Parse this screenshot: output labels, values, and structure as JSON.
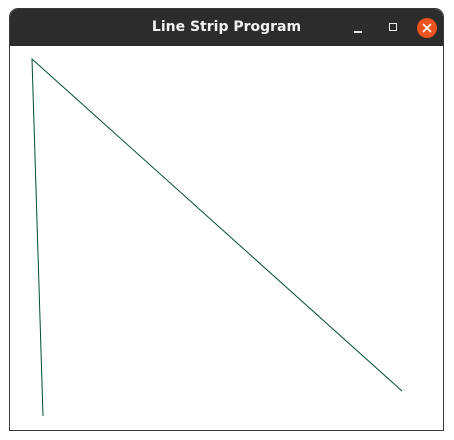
{
  "window": {
    "title": "Line Strip Program",
    "controls": {
      "minimize_icon": "minimize-icon",
      "maximize_icon": "maximize-icon",
      "close_icon": "close-icon",
      "close_color": "#e95420"
    }
  },
  "drawing": {
    "line_color": "#004d33",
    "background": "#ffffff"
  }
}
